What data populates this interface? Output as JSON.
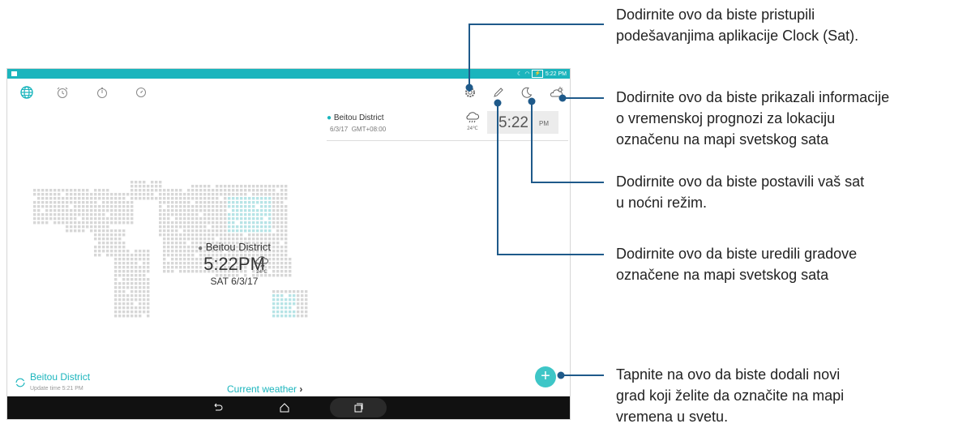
{
  "colors": {
    "accent": "#1bb5bd",
    "callout_line": "#1f5a8a",
    "navbar": "#111111"
  },
  "statusbar": {
    "time": "5:22 PM",
    "icons": [
      "moon-icon",
      "wifi-icon",
      "battery-icon"
    ]
  },
  "tabs": [
    {
      "name": "world-clock",
      "icon": "globe-icon",
      "active": true
    },
    {
      "name": "alarm",
      "icon": "alarm-clock-icon",
      "active": false
    },
    {
      "name": "stopwatch",
      "icon": "stopwatch-icon",
      "active": false
    },
    {
      "name": "timer",
      "icon": "timer-icon",
      "active": false
    }
  ],
  "toolbar": {
    "icons": [
      "settings-gear-icon",
      "edit-pencil-icon",
      "night-mode-moon-icon",
      "weather-cloud-sun-icon"
    ]
  },
  "city_card": {
    "city": "Beitou District",
    "date": "6/3/17",
    "gmt": "GMT+08:00",
    "temp": "24℃",
    "time": "5:22",
    "ampm": "PM"
  },
  "map_label": {
    "city": "Beitou District",
    "time": "5:22PM",
    "temp": "24℃",
    "date": "SAT 6/3/17"
  },
  "bottom": {
    "city": "Beitou District",
    "update": "Update time 5:21 PM",
    "current_weather": "Current weather"
  },
  "callouts": {
    "settings": [
      "Dodirnite ovo da biste pristupili",
      "podešavanjima aplikacije Clock (Sat)."
    ],
    "weather": [
      "Dodirnite ovo da biste prikazali informacije",
      "o vremenskoj prognozi za lokaciju",
      "označenu na mapi svetskog sata"
    ],
    "night": [
      "Dodirnite ovo da biste postavili vaš sat",
      "u noćni režim."
    ],
    "edit": [
      "Dodirnite ovo da biste uredili gradove",
      "označene na mapi svetskog sata"
    ],
    "add": [
      "Tapnite na ovo da biste dodali novi",
      "grad koji želite da označite na mapi",
      "vremena u svetu."
    ]
  }
}
